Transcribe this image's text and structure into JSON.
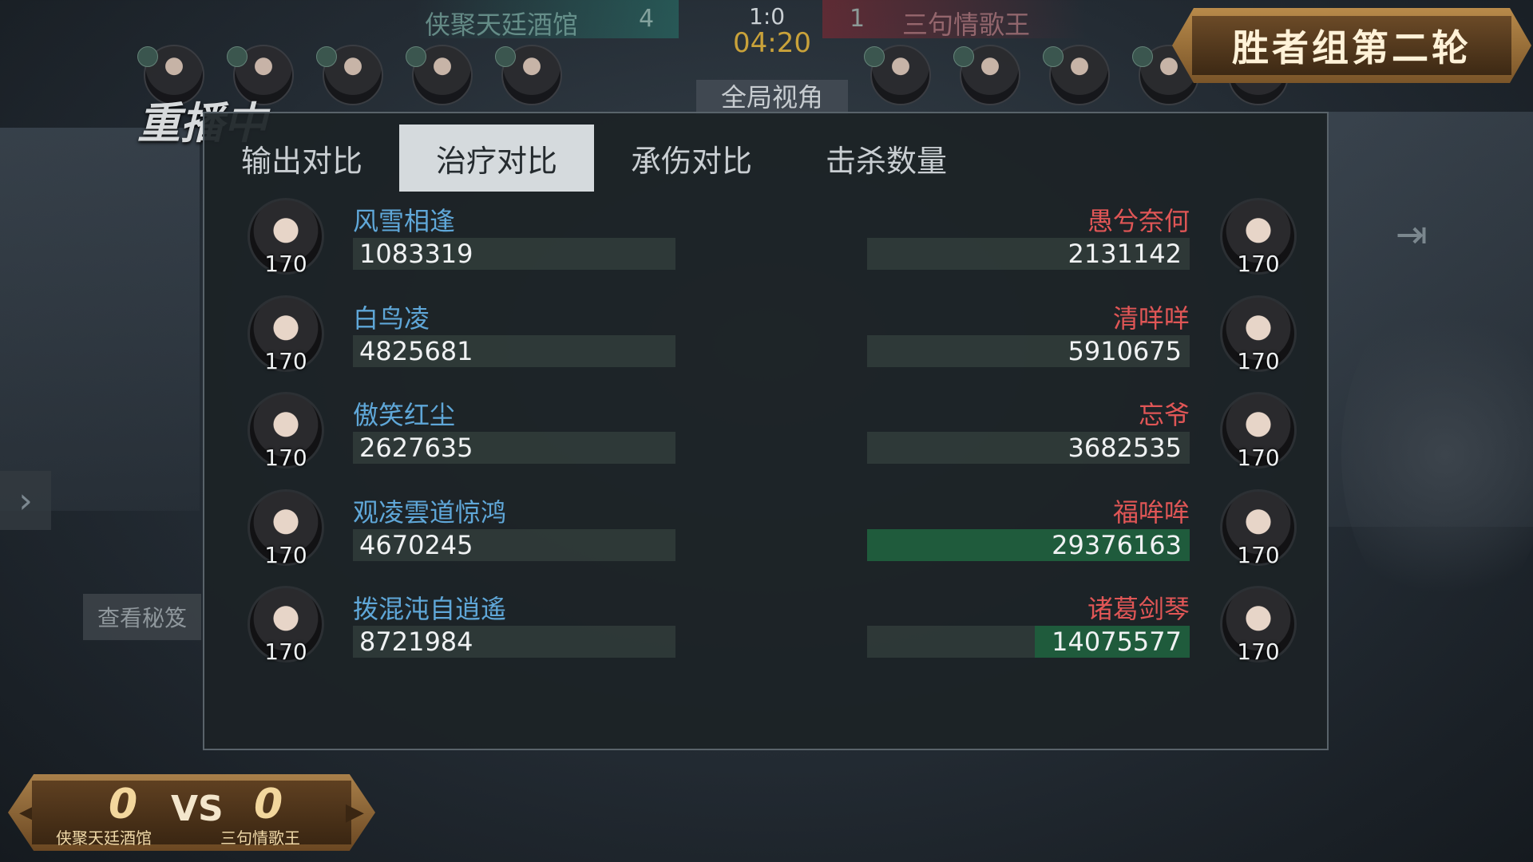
{
  "topbar": {
    "left_team": "侠聚天廷酒馆",
    "left_score": "4",
    "right_team": "三句情歌王",
    "right_score": "1",
    "match_score": "1:0",
    "time": "04:20",
    "global_view": "全局视角"
  },
  "title_banner": "胜者组第二轮",
  "replay_label": "重播中",
  "secret_button": "查看秘笈",
  "tabs": [
    "输出对比",
    "治疗对比",
    "承伤对比",
    "击杀数量"
  ],
  "active_tab": 1,
  "players": [
    {
      "left": {
        "name": "风雪相逢",
        "value": "1083319",
        "level": "170",
        "fill": 0
      },
      "right": {
        "name": "愚兮奈何",
        "value": "2131142",
        "level": "170",
        "fill": 0
      }
    },
    {
      "left": {
        "name": "白鸟凌",
        "value": "4825681",
        "level": "170",
        "fill": 0
      },
      "right": {
        "name": "清咩咩",
        "value": "5910675",
        "level": "170",
        "fill": 0
      }
    },
    {
      "left": {
        "name": "傲笑红尘",
        "value": "2627635",
        "level": "170",
        "fill": 0
      },
      "right": {
        "name": "忘爷",
        "value": "3682535",
        "level": "170",
        "fill": 0
      }
    },
    {
      "left": {
        "name": "观凌雲道惊鸿",
        "value": "4670245",
        "level": "170",
        "fill": 0
      },
      "right": {
        "name": "福哞哞",
        "value": "29376163",
        "level": "170",
        "fill": 1.0
      }
    },
    {
      "left": {
        "name": "拨混沌自逍遙",
        "value": "8721984",
        "level": "170",
        "fill": 0
      },
      "right": {
        "name": "诸葛剑琴",
        "value": "14075577",
        "level": "170",
        "fill": 0.48
      }
    }
  ],
  "vs_banner": {
    "left_score": "0",
    "vs": "VS",
    "right_score": "0",
    "left_team": "侠聚天廷酒馆",
    "right_team": "三句情歌王"
  },
  "colors": {
    "left_name": "#5fa7d8",
    "right_name": "#e05656",
    "bar_fill": "#1f5b3c",
    "timer": "#c9a23a"
  },
  "icons": [
    "exit-icon",
    "expand-arrow-icon",
    "banner-left-arrow-icon",
    "banner-right-arrow-icon"
  ]
}
